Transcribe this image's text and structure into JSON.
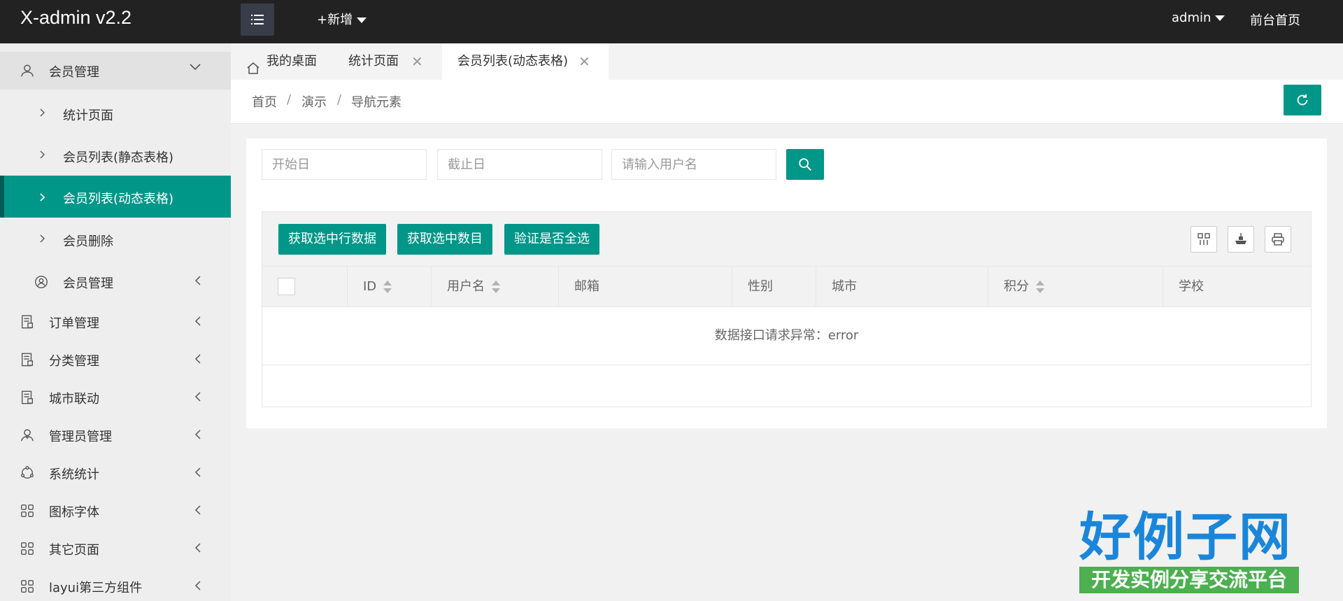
{
  "app": {
    "title": "X-admin v2.2",
    "add_label": "+新增",
    "user_label": "admin",
    "front_label": "前台首页"
  },
  "sidebar": {
    "items": [
      {
        "label": "会员管理",
        "icon": "user-icon",
        "expanded": true
      },
      {
        "label": "统计页面"
      },
      {
        "label": "会员列表(静态表格)"
      },
      {
        "label": "会员列表(动态表格)",
        "active": true
      },
      {
        "label": "会员删除"
      },
      {
        "label": "会员管理",
        "icon": "user-circle-icon"
      },
      {
        "label": "订单管理",
        "icon": "order-icon"
      },
      {
        "label": "分类管理",
        "icon": "category-icon"
      },
      {
        "label": "城市联动",
        "icon": "city-icon"
      },
      {
        "label": "管理员管理",
        "icon": "admin-icon"
      },
      {
        "label": "系统统计",
        "icon": "stats-icon"
      },
      {
        "label": "图标字体",
        "icon": "grid-icon"
      },
      {
        "label": "其它页面",
        "icon": "grid-icon"
      },
      {
        "label": "layui第三方组件",
        "icon": "grid-icon"
      }
    ]
  },
  "tabs": [
    {
      "label": "我的桌面",
      "icon": "home-icon"
    },
    {
      "label": "统计页面"
    },
    {
      "label": "会员列表(动态表格)",
      "current": true
    }
  ],
  "breadcrumb": [
    "首页",
    "演示",
    "导航元素"
  ],
  "breadcrumb_sep": "/",
  "search": {
    "start_placeholder": "开始日",
    "end_placeholder": "截止日",
    "username_placeholder": "请输入用户名"
  },
  "toolbar": {
    "btn_get_rows": "获取选中行数据",
    "btn_get_count": "获取选中数目",
    "btn_check_all": "验证是否全选"
  },
  "table": {
    "columns": [
      "ID",
      "用户名",
      "邮箱",
      "性别",
      "城市",
      "积分",
      "学校"
    ],
    "empty_message": "数据接口请求异常：error"
  },
  "watermark": {
    "big": "好例子网",
    "small": "开发实例分享交流平台"
  },
  "colors": {
    "accent": "#009688",
    "topbar": "#222222"
  }
}
